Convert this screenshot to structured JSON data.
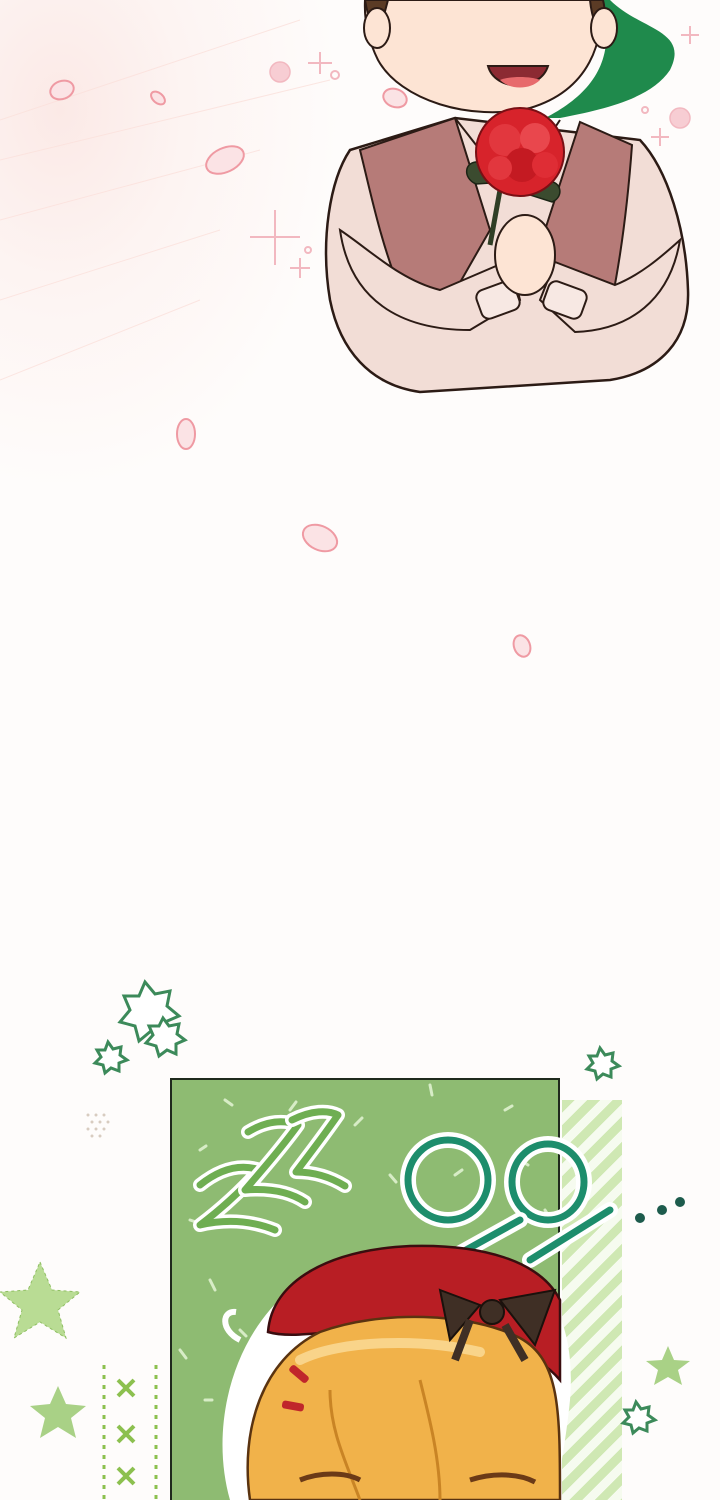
{
  "comic": {
    "upper_panel": {
      "character": "boy-holding-red-carnation",
      "background_tint": "#fbe9e6",
      "accent_green": "#1f8a4c",
      "vest_color": "#b67b78",
      "flower_color": "#d7232b"
    },
    "lower_panel": {
      "panel_bg": "#8ebb72",
      "sfx_sleep_icon": "zzz-sfx-icon",
      "sfx_speech_icon": "rings-sfx-icon",
      "character": "blonde-girl-red-beret",
      "beret_color": "#b81e24",
      "hair_color": "#f1b24a",
      "decoration_color": "#9cca6f"
    }
  }
}
